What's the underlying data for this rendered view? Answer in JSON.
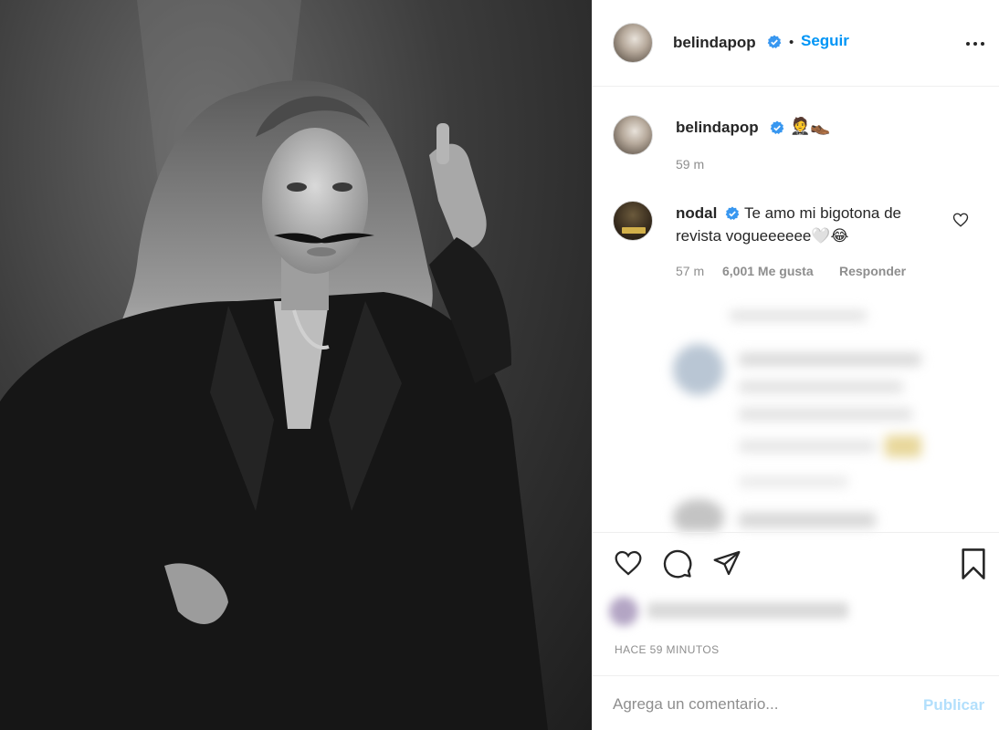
{
  "post": {
    "image_alt": "Black and white portrait photo"
  },
  "header": {
    "username": "belindapop",
    "separator": "•",
    "follow_label": "Seguir",
    "more_icon": "more-horizontal-icon"
  },
  "caption": {
    "username": "belindapop",
    "emojis": "🤵👞",
    "time": "59 m"
  },
  "comment": {
    "username": "nodal",
    "text_line1": "Te amo mi bigotona de",
    "text_line2": "revista vogueeeeee🤍😂",
    "time": "57 m",
    "likes": "6,001 Me gusta",
    "reply_label": "Responder"
  },
  "actions": {
    "like_icon": "heart-icon",
    "comment_icon": "comment-icon",
    "share_icon": "paper-plane-icon",
    "save_icon": "bookmark-icon"
  },
  "timestamp": "HACE 59 MINUTOS",
  "comment_box": {
    "placeholder": "Agrega un comentario...",
    "publish_label": "Publicar"
  },
  "colors": {
    "link_blue": "#0095f6",
    "publish_disabled": "#b2dffc",
    "verified_blue": "#3897f0",
    "muted_text": "#8e8e8e"
  }
}
